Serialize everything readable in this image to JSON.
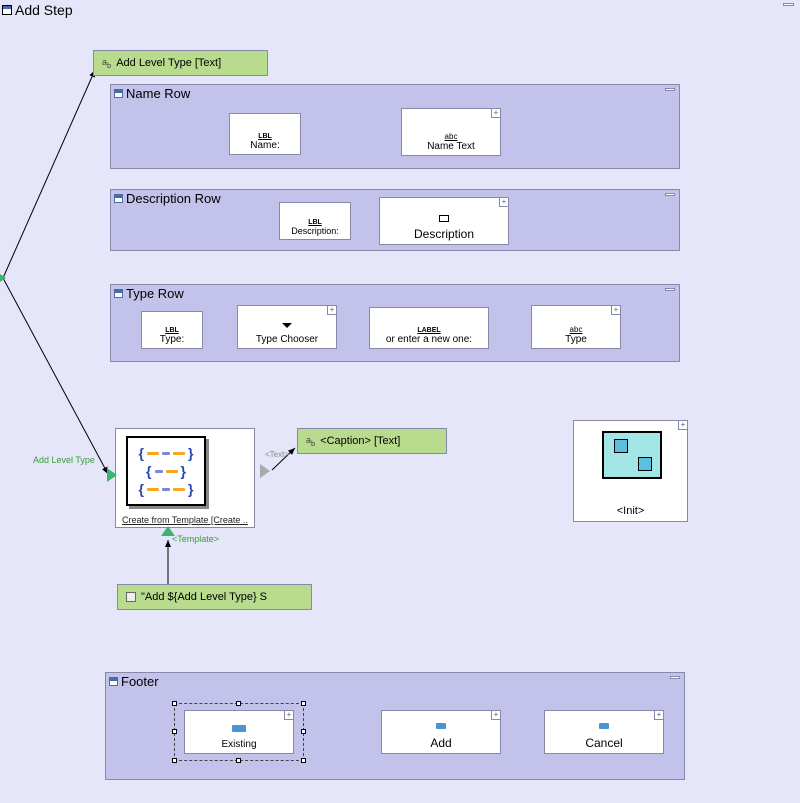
{
  "window": {
    "title": "Add  Step"
  },
  "nodes": {
    "addLevelType": {
      "label": "Add Level Type [Text]"
    },
    "caption": {
      "label": "<Caption> [Text]"
    },
    "templateString": {
      "label": "\"Add ${Add Level Type} S"
    }
  },
  "ports": {
    "addLevelType": "Add Level Type",
    "text": "<Text>",
    "template": "<Template>"
  },
  "panels": {
    "nameRow": {
      "title": "Name Row",
      "widgets": {
        "nameLabel": {
          "type": "LBL",
          "caption": "Name:"
        },
        "nameText": {
          "type": "abc",
          "caption": "Name Text"
        }
      }
    },
    "descRow": {
      "title": "Description Row",
      "widgets": {
        "descLabel": {
          "type": "LBL",
          "caption": "Description:"
        },
        "descText": {
          "type": "rect",
          "caption": "Description"
        }
      }
    },
    "typeRow": {
      "title": "Type Row",
      "widgets": {
        "typeLabel": {
          "type": "LBL",
          "caption": "Type:"
        },
        "typeChooser": {
          "type": "dd",
          "caption": "Type Chooser"
        },
        "orEnter": {
          "type": "LABEL",
          "caption": "or enter a new one:"
        },
        "typeText": {
          "type": "abc",
          "caption": "Type"
        }
      }
    },
    "footer": {
      "title": "Footer",
      "widgets": {
        "existing": {
          "caption": "Existing"
        },
        "add": {
          "caption": "Add"
        },
        "cancel": {
          "caption": "Cancel"
        }
      }
    }
  },
  "template": {
    "caption": "Create from Template [Create .."
  },
  "init": {
    "caption": "<Init>"
  }
}
